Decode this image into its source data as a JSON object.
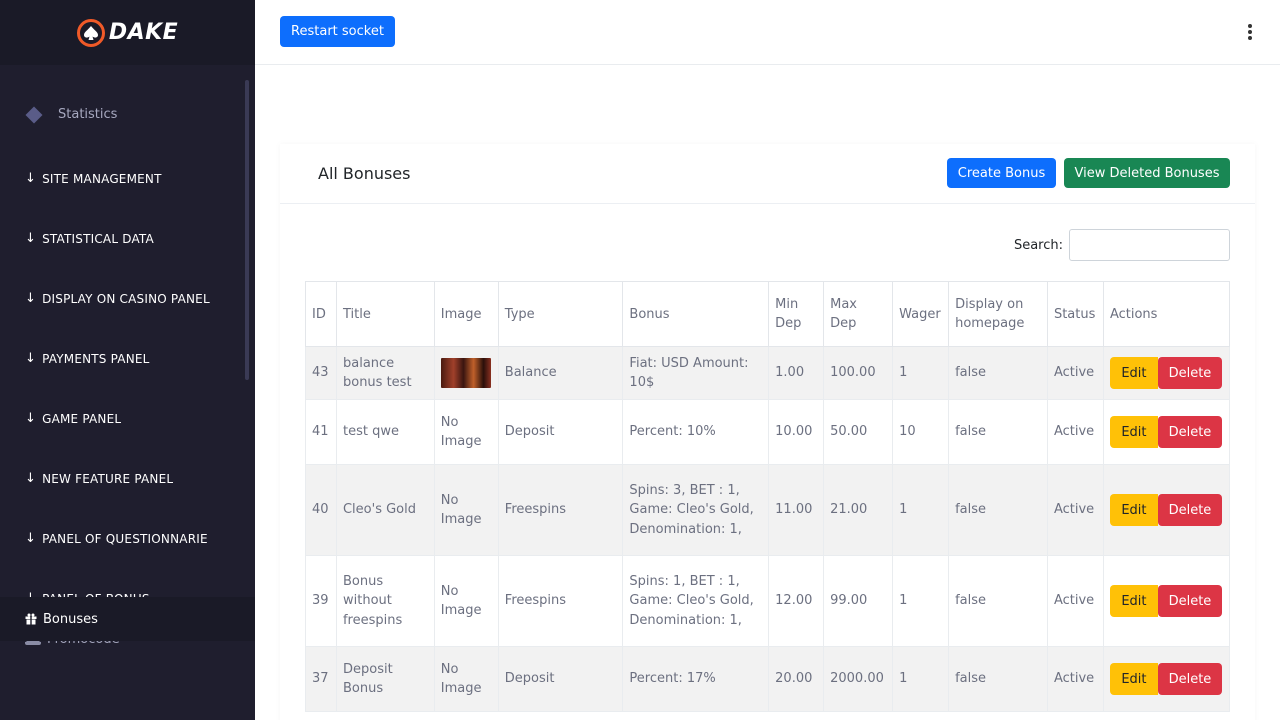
{
  "brand": {
    "name": "DAKE",
    "accent": "#f05a28"
  },
  "sidebar": {
    "statistics": "Statistics",
    "sections": [
      "SITE MANAGEMENT",
      "STATISTICAL DATA",
      "DISPLAY ON CASINO PANEL",
      "PAYMENTS PANEL",
      "GAME PANEL",
      "NEW FEATURE PANEL",
      "PANEL OF QUESTIONNARIE",
      "PANEL OF BONUS"
    ],
    "promocode": "Promocode",
    "bonuses": "Bonuses"
  },
  "topbar": {
    "restart_label": "Restart socket"
  },
  "card": {
    "title": "All Bonuses",
    "create_label": "Create Bonus",
    "deleted_label": "View Deleted Bonuses",
    "search_label": "Search:"
  },
  "table": {
    "headers": [
      "ID",
      "Title",
      "Image",
      "Type",
      "Bonus",
      "Min Dep",
      "Max Dep",
      "Wager",
      "Display on homepage",
      "Status",
      "Actions"
    ],
    "edit_label": "Edit",
    "delete_label": "Delete",
    "no_image": "No Image",
    "rows": [
      {
        "id": "43",
        "title": "balance bonus test",
        "image": "thumbnail",
        "type": "Balance",
        "bonus": "Fiat: USD Amount: 10$",
        "min_dep": "1.00",
        "max_dep": "100.00",
        "wager": "1",
        "display": "false",
        "status": "Active"
      },
      {
        "id": "41",
        "title": "test qwe",
        "image": "No Image",
        "type": "Deposit",
        "bonus": "Percent: 10%",
        "min_dep": "10.00",
        "max_dep": "50.00",
        "wager": "10",
        "display": "false",
        "status": "Active"
      },
      {
        "id": "40",
        "title": "Cleo's Gold",
        "image": "No Image",
        "type": "Freespins",
        "bonus": "Spins: 3, BET : 1, Game: Cleo's Gold, Denomination: 1,",
        "min_dep": "11.00",
        "max_dep": "21.00",
        "wager": "1",
        "display": "false",
        "status": "Active"
      },
      {
        "id": "39",
        "title": "Bonus without freespins",
        "image": "No Image",
        "type": "Freespins",
        "bonus": "Spins: 1, BET : 1, Game: Cleo's Gold, Denomination: 1,",
        "min_dep": "12.00",
        "max_dep": "99.00",
        "wager": "1",
        "display": "false",
        "status": "Active"
      },
      {
        "id": "37",
        "title": "Deposit Bonus",
        "image": "No Image",
        "type": "Deposit",
        "bonus": "Percent: 17%",
        "min_dep": "20.00",
        "max_dep": "2000.00",
        "wager": "1",
        "display": "false",
        "status": "Active"
      }
    ]
  }
}
